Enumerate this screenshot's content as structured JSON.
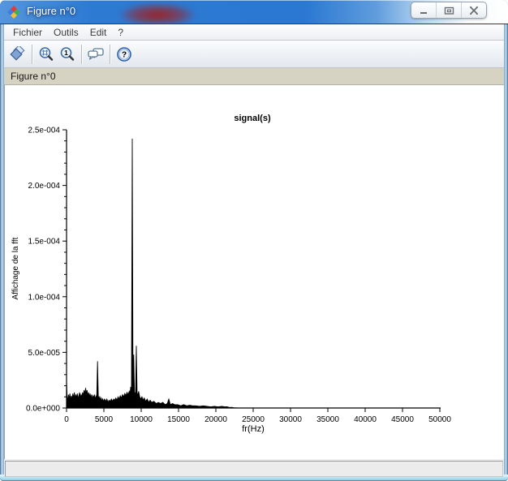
{
  "window": {
    "title": "Figure n°0",
    "app_icon": "scilab-logo-icon",
    "controls": [
      {
        "name": "minimize-button",
        "icon": "minimize-icon"
      },
      {
        "name": "maximize-button",
        "icon": "maximize-icon"
      },
      {
        "name": "close-button",
        "icon": "close-icon"
      }
    ]
  },
  "menu_bar": {
    "items": [
      "Fichier",
      "Outils",
      "Edit",
      "?"
    ]
  },
  "toolbar": {
    "buttons": [
      {
        "name": "rotate-3d-button",
        "icon": "rotate-icon"
      },
      {
        "name": "zoom-area-button",
        "icon": "zoom-area-icon"
      },
      {
        "name": "zoom-original-button",
        "icon": "zoom-reset-icon"
      },
      {
        "name": "datatip-button",
        "icon": "speech-bubbles-icon"
      },
      {
        "name": "help-button",
        "icon": "help-icon"
      }
    ]
  },
  "figure_label": "Figure n°0",
  "status_bar": {
    "text": ""
  },
  "colors": {
    "titlebar_blue": "#2a78d2",
    "frame_blue": "#bfdcf2",
    "strip_beige": "#d7d3c3",
    "series_color": "#000000"
  },
  "chart_data": {
    "type": "area",
    "title": "signal(s)",
    "xlabel": "fr(Hz)",
    "ylabel": "Affichage de la fft",
    "xlim": [
      0,
      50000
    ],
    "ylim": [
      0,
      0.00025
    ],
    "grid": false,
    "legend": "none",
    "x_ticks": [
      0,
      5000,
      10000,
      15000,
      20000,
      25000,
      30000,
      35000,
      40000,
      45000,
      50000
    ],
    "y_ticks": [
      {
        "value": 0.0,
        "label": "0.0e+000"
      },
      {
        "value": 5e-05,
        "label": "5.0e-005"
      },
      {
        "value": 0.0001,
        "label": "1.0e-004"
      },
      {
        "value": 0.00015,
        "label": "1.5e-004"
      },
      {
        "value": 0.0002,
        "label": "2.0e-004"
      },
      {
        "value": 0.00025,
        "label": "2.5e-004"
      }
    ],
    "y_minor_step": 1e-05,
    "series_color": "#000000",
    "main_peaks": [
      {
        "freq": 8800,
        "amp": 0.000242
      },
      {
        "freq": 9350,
        "amp": 5.6e-05
      },
      {
        "freq": 9000,
        "amp": 4.8e-05
      },
      {
        "freq": 4150,
        "amp": 4.2e-05
      },
      {
        "freq": 0,
        "amp": 2.4e-05
      },
      {
        "freq": 13700,
        "amp": 8e-06
      }
    ],
    "points": [
      [
        0,
        2.4e-05
      ],
      [
        80,
        1e-05
      ],
      [
        150,
        6e-06
      ],
      [
        250,
        1.2e-05
      ],
      [
        350,
        8e-06
      ],
      [
        450,
        1.3e-05
      ],
      [
        550,
        7e-06
      ],
      [
        650,
        1.1e-05
      ],
      [
        750,
        8e-06
      ],
      [
        850,
        1.3e-05
      ],
      [
        950,
        9e-06
      ],
      [
        1050,
        1.4e-05
      ],
      [
        1150,
        8e-06
      ],
      [
        1250,
        1.2e-05
      ],
      [
        1350,
        9e-06
      ],
      [
        1450,
        1.3e-05
      ],
      [
        1550,
        8e-06
      ],
      [
        1650,
        1.1e-05
      ],
      [
        1750,
        1.4e-05
      ],
      [
        1850,
        9e-06
      ],
      [
        1950,
        1.2e-05
      ],
      [
        2050,
        1e-05
      ],
      [
        2150,
        1.4e-05
      ],
      [
        2250,
        1.1e-05
      ],
      [
        2350,
        1.6e-05
      ],
      [
        2450,
        1.2e-05
      ],
      [
        2550,
        1.8e-05
      ],
      [
        2650,
        1.3e-05
      ],
      [
        2750,
        1.6e-05
      ],
      [
        2850,
        1.1e-05
      ],
      [
        2950,
        1.4e-05
      ],
      [
        3050,
        1e-05
      ],
      [
        3150,
        1.3e-05
      ],
      [
        3250,
        9e-06
      ],
      [
        3350,
        1.2e-05
      ],
      [
        3450,
        8e-06
      ],
      [
        3550,
        1.1e-05
      ],
      [
        3650,
        9e-06
      ],
      [
        3750,
        1.2e-05
      ],
      [
        3850,
        8e-06
      ],
      [
        3950,
        1e-05
      ],
      [
        4050,
        1.2e-05
      ],
      [
        4150,
        4.2e-05
      ],
      [
        4250,
        1.1e-05
      ],
      [
        4350,
        8e-06
      ],
      [
        4450,
        1e-05
      ],
      [
        4550,
        7e-06
      ],
      [
        4650,
        9e-06
      ],
      [
        4750,
        6e-06
      ],
      [
        4850,
        8e-06
      ],
      [
        4950,
        6e-06
      ],
      [
        5100,
        8e-06
      ],
      [
        5250,
        6e-06
      ],
      [
        5400,
        8e-06
      ],
      [
        5550,
        5e-06
      ],
      [
        5700,
        7e-06
      ],
      [
        5850,
        6e-06
      ],
      [
        6000,
        8e-06
      ],
      [
        6150,
        6e-06
      ],
      [
        6300,
        8e-06
      ],
      [
        6450,
        7e-06
      ],
      [
        6600,
        9e-06
      ],
      [
        6750,
        7e-06
      ],
      [
        6900,
        1e-05
      ],
      [
        7050,
        8e-06
      ],
      [
        7200,
        1.1e-05
      ],
      [
        7350,
        9e-06
      ],
      [
        7500,
        1.2e-05
      ],
      [
        7650,
        1e-05
      ],
      [
        7800,
        1.3e-05
      ],
      [
        7950,
        1.1e-05
      ],
      [
        8100,
        1.4e-05
      ],
      [
        8250,
        1.2e-05
      ],
      [
        8400,
        1.5e-05
      ],
      [
        8500,
        1.3e-05
      ],
      [
        8600,
        1.9e-05
      ],
      [
        8700,
        1.5e-05
      ],
      [
        8800,
        0.000242
      ],
      [
        8900,
        1.6e-05
      ],
      [
        9000,
        4.8e-05
      ],
      [
        9100,
        1.4e-05
      ],
      [
        9250,
        1.3e-05
      ],
      [
        9350,
        5.6e-05
      ],
      [
        9450,
        1.4e-05
      ],
      [
        9550,
        1.1e-05
      ],
      [
        9650,
        1.5e-05
      ],
      [
        9800,
        1e-05
      ],
      [
        9950,
        8e-06
      ],
      [
        10100,
        1e-05
      ],
      [
        10250,
        7e-06
      ],
      [
        10400,
        9e-06
      ],
      [
        10600,
        6e-06
      ],
      [
        10800,
        8e-06
      ],
      [
        11000,
        5e-06
      ],
      [
        11200,
        7e-06
      ],
      [
        11400,
        5e-06
      ],
      [
        11700,
        6e-06
      ],
      [
        12000,
        4e-06
      ],
      [
        12300,
        5e-06
      ],
      [
        12600,
        4e-06
      ],
      [
        12900,
        5e-06
      ],
      [
        13200,
        3e-06
      ],
      [
        13500,
        4e-06
      ],
      [
        13700,
        8e-06
      ],
      [
        13900,
        3e-06
      ],
      [
        14200,
        4e-06
      ],
      [
        14500,
        3e-06
      ],
      [
        14900,
        3e-06
      ],
      [
        15300,
        2e-06
      ],
      [
        15700,
        3e-06
      ],
      [
        16100,
        2e-06
      ],
      [
        16500,
        2.5e-06
      ],
      [
        16900,
        2e-06
      ],
      [
        17300,
        2e-06
      ],
      [
        17800,
        1.5e-06
      ],
      [
        18300,
        2e-06
      ],
      [
        18800,
        1.5e-06
      ],
      [
        19300,
        1e-06
      ],
      [
        19800,
        1.5e-06
      ],
      [
        20300,
        1e-06
      ],
      [
        20800,
        1.5e-06
      ],
      [
        21200,
        1e-06
      ],
      [
        21500,
        1.2e-06
      ],
      [
        21800,
        5e-07
      ],
      [
        22100,
        6e-07
      ],
      [
        22400,
        2e-07
      ],
      [
        23000,
        0
      ],
      [
        50000,
        0
      ]
    ]
  }
}
